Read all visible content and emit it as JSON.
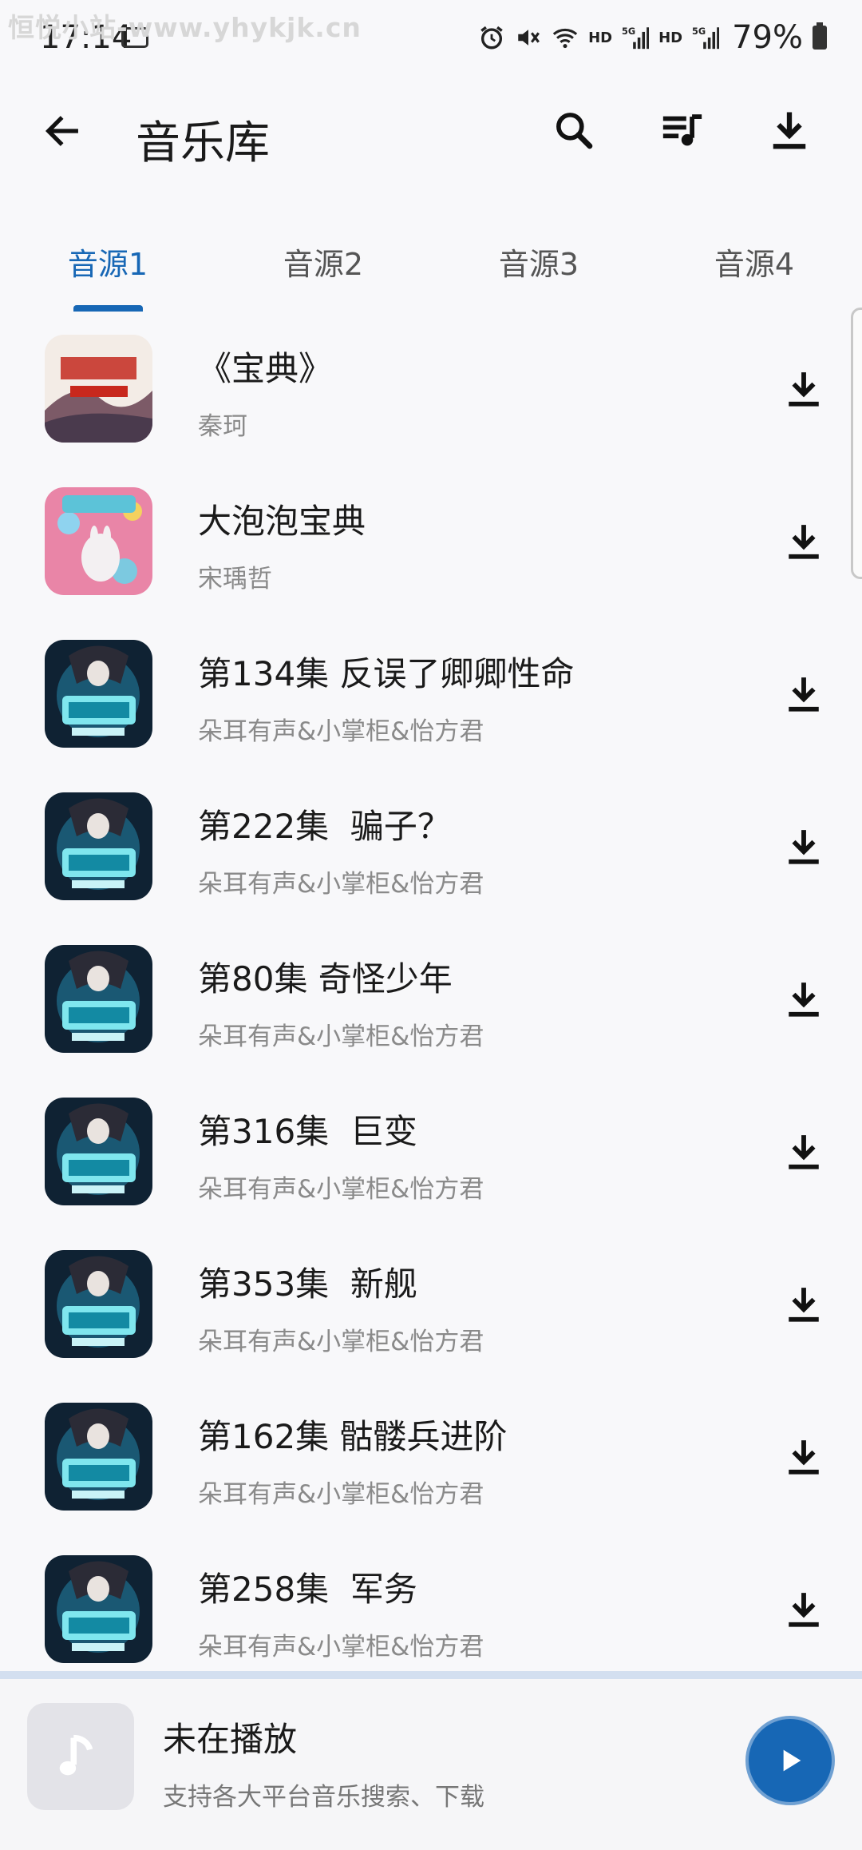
{
  "watermark": "恒悦小站-www.yhykjk.cn",
  "status": {
    "time": "17:14",
    "signal1": "HD",
    "signal2": "HD",
    "battery": "79%"
  },
  "header": {
    "title": "音乐库",
    "icons": [
      "back-arrow-icon",
      "search-icon",
      "playlist-icon",
      "download-icon"
    ]
  },
  "tabs": [
    {
      "label": "音源1",
      "active": true
    },
    {
      "label": "音源2",
      "active": false
    },
    {
      "label": "音源3",
      "active": false
    },
    {
      "label": "音源4",
      "active": false
    }
  ],
  "tracks": [
    {
      "title": "《宝典》",
      "artist": "秦珂",
      "cover": "cover-red"
    },
    {
      "title": "大泡泡宝典",
      "artist": "宋瑀哲",
      "cover": "cover-pink"
    },
    {
      "title": "第134集 反误了卿卿性命",
      "artist": "朵耳有声&小掌柜&怡方君",
      "cover": "cover-blue"
    },
    {
      "title": "第222集  骗子？",
      "artist": "朵耳有声&小掌柜&怡方君",
      "cover": "cover-blue"
    },
    {
      "title": "第80集 奇怪少年",
      "artist": "朵耳有声&小掌柜&怡方君",
      "cover": "cover-blue"
    },
    {
      "title": "第316集  巨变",
      "artist": "朵耳有声&小掌柜&怡方君",
      "cover": "cover-blue"
    },
    {
      "title": "第353集  新舰",
      "artist": "朵耳有声&小掌柜&怡方君",
      "cover": "cover-blue"
    },
    {
      "title": "第162集 骷髅兵进阶",
      "artist": "朵耳有声&小掌柜&怡方君",
      "cover": "cover-blue"
    },
    {
      "title": "第258集  军务",
      "artist": "朵耳有声&小掌柜&怡方君",
      "cover": "cover-blue"
    }
  ],
  "player": {
    "title": "未在播放",
    "subtitle": "支持各大平台音乐搜索、下载"
  },
  "colors": {
    "accent": "#1767b5",
    "background": "#f8f8fa",
    "subtext": "#8a8a8a"
  }
}
